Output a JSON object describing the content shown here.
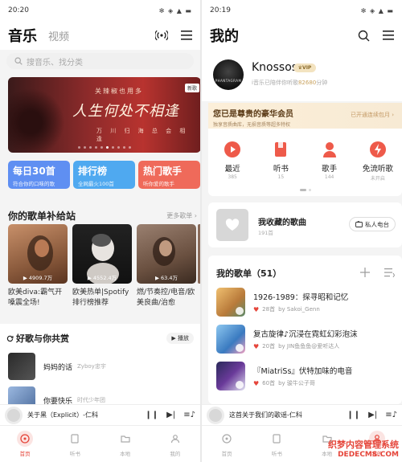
{
  "left": {
    "status": {
      "time": "20:20"
    },
    "header": {
      "title": "音乐",
      "video_tab": "视频"
    },
    "search": {
      "placeholder": "搜音乐、找分类"
    },
    "banner": {
      "line1": "关辣椒也用多",
      "line2": "人生何处不相逢",
      "line3": "万 川 归 海  总 会 相 逢",
      "tag": "新歌"
    },
    "chips": [
      {
        "title": "每日30首",
        "sub": "符合你的口味的歌",
        "color": "#5f8ff2"
      },
      {
        "title": "排行榜",
        "sub": "全网最火100首",
        "color": "#4fa9f0"
      },
      {
        "title": "热门歌手",
        "sub": "听你爱的歌手",
        "color": "#ef6a5a"
      }
    ],
    "section1": {
      "title": "你的歌单补给站",
      "more": "更多歌单 ›"
    },
    "albums": [
      {
        "count": "▶ 4909.7万",
        "title": "欧美diva:霸气开嗓震全场!"
      },
      {
        "count": "▶ 4552.4万",
        "title": "欧美热单|Spotify排行榜推荐"
      },
      {
        "count": "▶ 63.4万",
        "title": "燃/节奏控/电音/欧美良曲/治愈"
      }
    ],
    "section2": {
      "title": "好歌与你共赏",
      "play": "▶ 播放"
    },
    "songs": [
      {
        "name": "妈妈的话",
        "artist": "Zyboy忠宇"
      },
      {
        "name": "你要快乐",
        "artist": "时代少年团"
      }
    ],
    "player": {
      "text": "关于黑（Explicit）-仁科"
    },
    "tabs": [
      "首页",
      "听书",
      "本地",
      "我的"
    ]
  },
  "right": {
    "status": {
      "time": "20:19"
    },
    "header": {
      "title": "我的"
    },
    "profile": {
      "name": "Knossos",
      "vip": "VIP",
      "sub_prefix": "i音乐已陪伴你听歌",
      "minutes": "82680",
      "sub_suffix": "分钟",
      "avatar_text": "PHANTAGRAM"
    },
    "vip_banner": {
      "title": "您已是尊贵的豪华会员",
      "sub": "独享音质曲库，无损音质等超多特权",
      "action": "已开通连续包月 ›"
    },
    "quick": [
      {
        "label": "最近",
        "count": "385"
      },
      {
        "label": "听书",
        "count": "15"
      },
      {
        "label": "歌手",
        "count": "144"
      },
      {
        "label": "免流听歌",
        "count": "未开启"
      }
    ],
    "favorites": {
      "title": "我收藏的歌曲",
      "count": "191首",
      "radio": "私人电台"
    },
    "playlists": {
      "title": "我的歌单（51）",
      "items": [
        {
          "name": "1926-1989：探寻昭和记忆",
          "likes": "28首",
          "by": "by Sakoi_Genn"
        },
        {
          "name": "复古旋律♪沉浸在霓虹幻彩泡沫",
          "likes": "20首",
          "by": "by JIN鱼鱼鱼@爱听达人"
        },
        {
          "name": "『MiatriSs』伏特加味的电音",
          "likes": "60首",
          "by": "by 骏牛公子哥"
        }
      ]
    },
    "player": {
      "text": "这首关于我们的歌谣-仁科"
    },
    "tabs": [
      "首页",
      "听书",
      "本地",
      "我的"
    ],
    "watermark": {
      "line1": "织梦内容管理系统",
      "line2": "DEDECMS.COM"
    }
  }
}
